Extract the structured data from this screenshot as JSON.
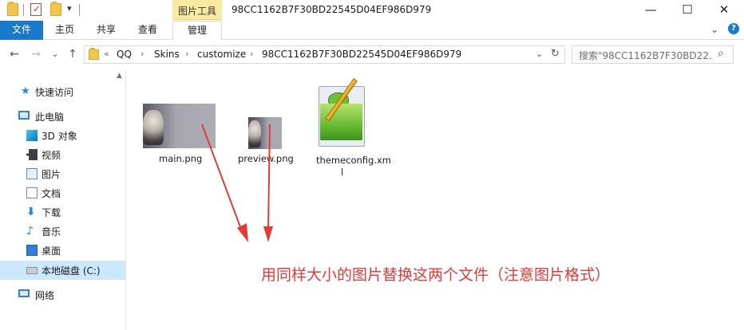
{
  "titlebar": {
    "contextual_tab": "图片工具",
    "window_title": "98CC1162B7F30BD22545D04EF986D979",
    "minimize": "—",
    "maximize": "☐",
    "close": "✕",
    "quick_access_dropdown": "▾"
  },
  "ribbon": {
    "tabs": [
      {
        "label": "文件"
      },
      {
        "label": "主页"
      },
      {
        "label": "共享"
      },
      {
        "label": "查看"
      },
      {
        "label": "管理"
      }
    ],
    "expand_icon": "⌄",
    "help_icon": "?"
  },
  "address": {
    "back": "←",
    "forward": "→",
    "recent": "⌄",
    "up": "↑",
    "overflow": "«",
    "crumbs": [
      "QQ",
      "Skins",
      "customize",
      "98CC1162B7F30BD22545D04EF986D979"
    ],
    "sep": "›",
    "dropdown": "⌄",
    "refresh": "↻",
    "search_placeholder": "搜索\"98CC1162B7F30BD22...",
    "search_icon": "⌕"
  },
  "nav": {
    "items": [
      {
        "label": "快速访问",
        "icon": "star-icon"
      },
      {
        "label": "此电脑",
        "icon": "computer-icon"
      },
      {
        "label": "3D 对象",
        "icon": "3d-objects-icon"
      },
      {
        "label": "视频",
        "icon": "video-icon"
      },
      {
        "label": "图片",
        "icon": "pictures-icon"
      },
      {
        "label": "文档",
        "icon": "documents-icon"
      },
      {
        "label": "下载",
        "icon": "downloads-icon"
      },
      {
        "label": "音乐",
        "icon": "music-icon"
      },
      {
        "label": "桌面",
        "icon": "desktop-icon"
      },
      {
        "label": "本地磁盘 (C:)",
        "icon": "drive-icon"
      },
      {
        "label": "网络",
        "icon": "network-icon"
      }
    ],
    "selected_index": 9,
    "scroll_up": "▲"
  },
  "files": [
    {
      "name": "main.png"
    },
    {
      "name": "preview.png"
    },
    {
      "name_line1": "themeconfig.xm",
      "name_line2": "l"
    }
  ],
  "annotation": {
    "text": "用同样大小的图片替换这两个文件（注意图片格式）",
    "color": "#e53935"
  },
  "colors": {
    "accent": "#1979ca",
    "selected": "#cce8ff",
    "contextual_tab": "#f9e9a1"
  }
}
